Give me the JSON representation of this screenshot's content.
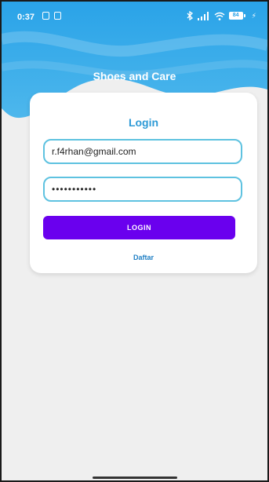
{
  "status_bar": {
    "time": "0:37",
    "battery": "84"
  },
  "header": {
    "title": "Shoes and Care"
  },
  "login_card": {
    "title": "Login",
    "email_value": "r.f4rhan@gmail.com",
    "password_value": "password123",
    "login_label": "LOGIN",
    "register_label": "Daftar"
  },
  "colors": {
    "header_top": "#2aa3e8",
    "header_bottom": "#4db7ec",
    "card_title": "#2e9ad6",
    "field_border": "#5ec2e0",
    "login_button": "#6a00ee",
    "register_link": "#1f7fc4",
    "background": "#efefef"
  },
  "icons": {
    "notifications": [
      "notification-icon",
      "notification-icon"
    ],
    "status": [
      "bluetooth-icon",
      "signal-icon",
      "wifi-icon",
      "battery-icon",
      "charging-icon"
    ]
  }
}
